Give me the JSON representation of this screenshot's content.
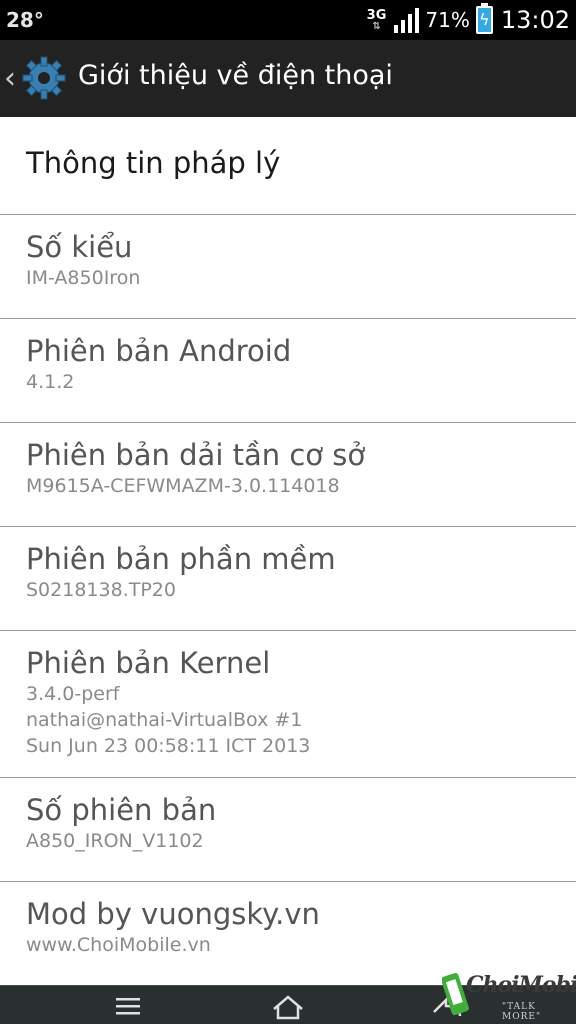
{
  "status_bar": {
    "temperature": "28°",
    "network": "3G",
    "battery_percent": "71%",
    "time": "13:02",
    "icons": [
      "network-3g-icon",
      "signal-bars-icon",
      "battery-charging-icon"
    ]
  },
  "action_bar": {
    "title": "Giới thiệu về điện thoại",
    "icons": [
      "back-chevron-icon",
      "settings-gear-icon"
    ],
    "accent": "#222222"
  },
  "items": [
    {
      "title": "Thông tin pháp lý"
    },
    {
      "title": "Số kiểu",
      "value": "IM-A850Iron"
    },
    {
      "title": "Phiên bản Android",
      "value": "4.1.2"
    },
    {
      "title": "Phiên bản dải tần cơ sở",
      "value": "M9615A-CEFWMAZM-3.0.114018"
    },
    {
      "title": "Phiên bản phần mềm",
      "value": "S0218138.TP20"
    },
    {
      "title": "Phiên bản Kernel",
      "value_lines": [
        "3.4.0-perf",
        "nathai@nathai-VirtualBox #1",
        "Sun Jun 23 00:58:11 ICT 2013"
      ]
    },
    {
      "title": "Số phiên bản",
      "value": "A850_IRON_V1102"
    },
    {
      "title": "Mod by vuongsky.vn",
      "value": "www.ChoiMobile.vn"
    }
  ],
  "nav_bar": {
    "icons": [
      "menu-icon",
      "home-icon",
      "back-icon"
    ]
  },
  "watermark": {
    "brand": "ChoiMobile",
    "slogan": "\"TALK MORE\""
  }
}
